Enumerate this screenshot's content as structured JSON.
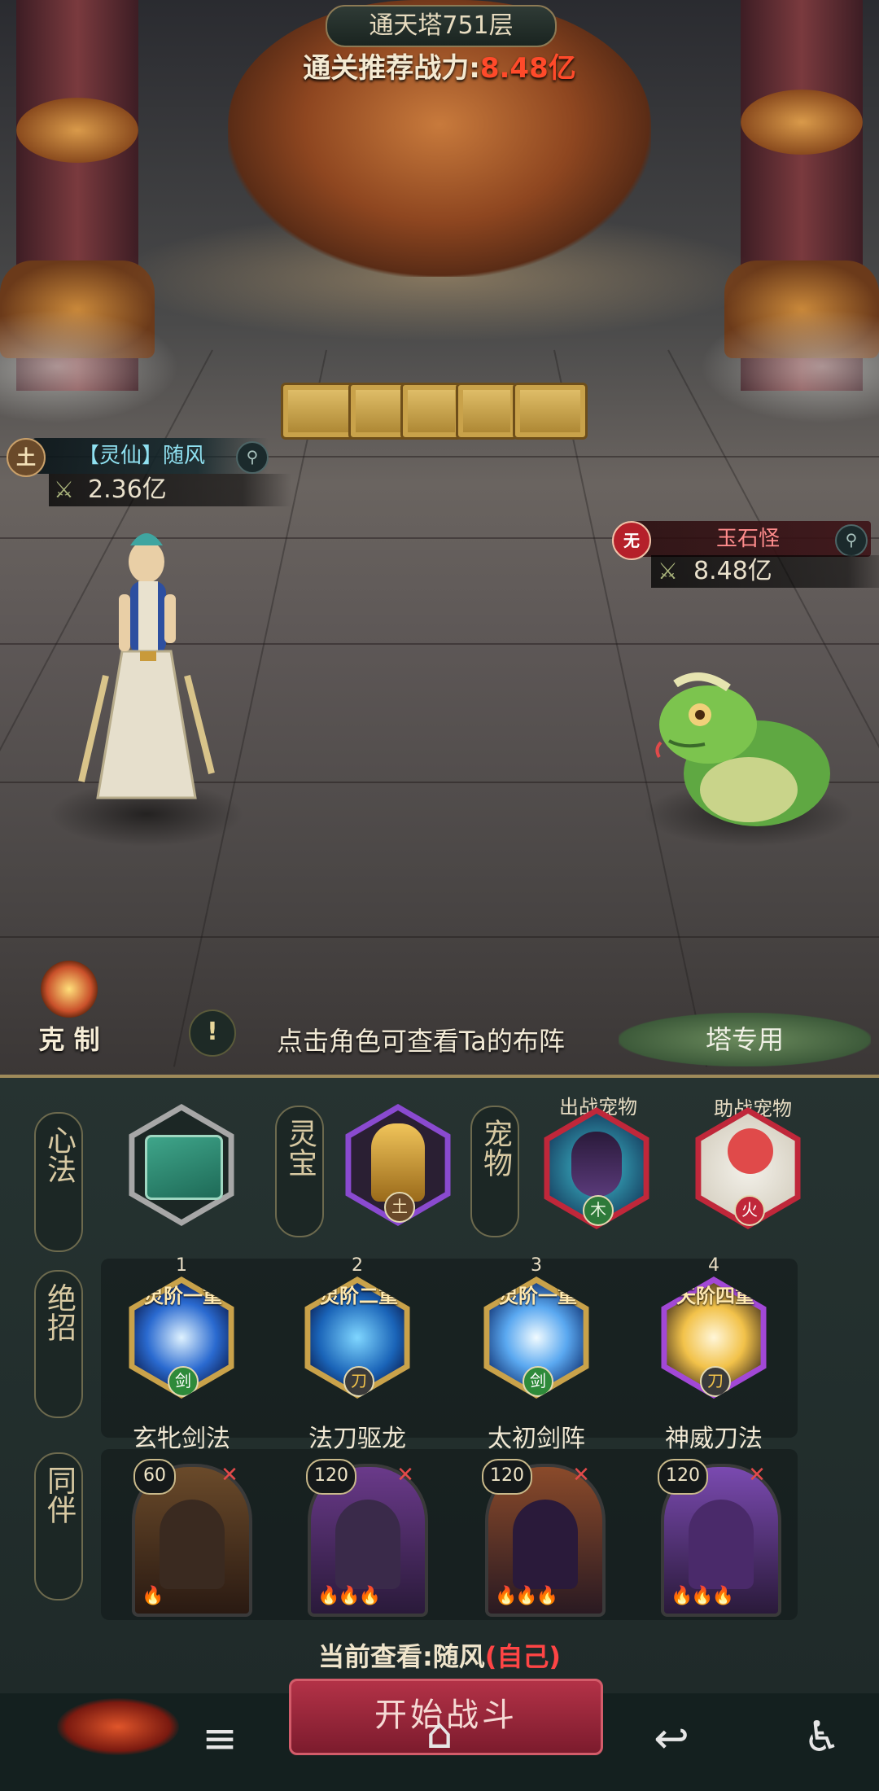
{
  "tower": {
    "title": "通天塔751层",
    "power_prefix": "通关推荐战力:",
    "power_value": "8.48亿"
  },
  "player": {
    "element": "土",
    "name": "【灵仙】随风",
    "power": "2.36亿"
  },
  "enemy": {
    "element": "无",
    "name": "玉石怪",
    "power": "8.48亿"
  },
  "scene": {
    "restrain_label": "克 制",
    "hint_icon": "!",
    "hint_text": "点击角色可查看Ta的布阵",
    "tower_only_label": "塔专用"
  },
  "equipment": {
    "xinfa_label": "心法",
    "lingbao_label": "灵宝",
    "lingbao_element": "土",
    "pet_label": "宠物",
    "battle_pet_label": "出战宠物",
    "battle_pet_element": "木",
    "assist_pet_label": "助战宠物",
    "assist_pet_element": "火"
  },
  "skills": {
    "side_label": "绝招",
    "items": [
      {
        "num": "1",
        "tier": "灵阶一重",
        "name": "玄牝剑法",
        "type": "剑"
      },
      {
        "num": "2",
        "tier": "灵阶二重",
        "name": "法刀驱龙",
        "type": "刀"
      },
      {
        "num": "3",
        "tier": "灵阶一重",
        "name": "太初剑阵",
        "type": "剑"
      },
      {
        "num": "4",
        "tier": "天阶四重",
        "name": "神威刀法",
        "type": "刀"
      }
    ]
  },
  "companions": {
    "side_label": "同伴",
    "items": [
      {
        "level": "60",
        "flames": "🔥"
      },
      {
        "level": "120",
        "flames": "🔥🔥🔥"
      },
      {
        "level": "120",
        "flames": "🔥🔥🔥"
      },
      {
        "level": "120",
        "flames": "🔥🔥🔥"
      }
    ]
  },
  "current_view": {
    "prefix": "当前查看:",
    "name": "随风",
    "self": "(自己)"
  },
  "start_button": "开始战斗",
  "colors": {
    "accent_red": "#ff4a2a",
    "panel_bg": "#263331",
    "gold": "#c9a24a"
  },
  "icons": {
    "search": "magnifier-icon",
    "menu": "menu-icon",
    "home": "home-icon",
    "back": "back-icon",
    "accessibility": "accessibility-icon"
  }
}
